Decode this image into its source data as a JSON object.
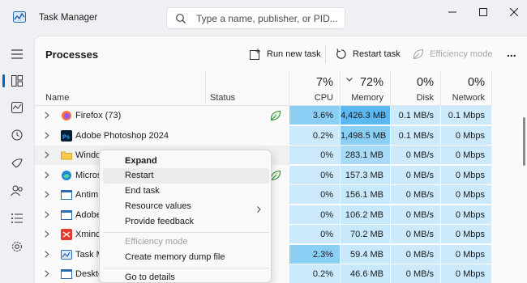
{
  "window": {
    "title": "Task Manager",
    "search_placeholder": "Type a name, publisher, or PID..."
  },
  "toolbar": {
    "page_title": "Processes",
    "run_new_task": "Run new task",
    "restart_task": "Restart task",
    "efficiency_mode": "Efficiency mode",
    "more": "..."
  },
  "columns": {
    "name": "Name",
    "status": "Status",
    "cpu": {
      "pct": "7%",
      "label": "CPU"
    },
    "memory": {
      "pct": "72%",
      "label": "Memory"
    },
    "disk": {
      "pct": "0%",
      "label": "Disk"
    },
    "network": {
      "pct": "0%",
      "label": "Network"
    }
  },
  "processes": [
    {
      "name": "Firefox (73)",
      "icon": "firefox-icon",
      "efficiency": true,
      "cpu": "3.6%",
      "memory": "4,426.3 MB",
      "disk": "0.1 MB/s",
      "network": "0.1 Mbps"
    },
    {
      "name": "Adobe Photoshop 2024",
      "icon": "photoshop-icon",
      "efficiency": false,
      "cpu": "0.2%",
      "memory": "1,498.5 MB",
      "disk": "0.1 MB/s",
      "network": "0 Mbps"
    },
    {
      "name": "Windo",
      "icon": "folder-icon",
      "efficiency": false,
      "cpu": "0%",
      "memory": "283.1 MB",
      "disk": "0 MB/s",
      "network": "0 Mbps"
    },
    {
      "name": "Micros",
      "icon": "edge-icon",
      "efficiency": true,
      "cpu": "0%",
      "memory": "157.3 MB",
      "disk": "0 MB/s",
      "network": "0 Mbps"
    },
    {
      "name": "Antim",
      "icon": "window-icon",
      "efficiency": false,
      "cpu": "0%",
      "memory": "156.1 MB",
      "disk": "0 MB/s",
      "network": "0 Mbps"
    },
    {
      "name": "Adobe",
      "icon": "window-icon",
      "efficiency": false,
      "cpu": "0%",
      "memory": "106.2 MB",
      "disk": "0 MB/s",
      "network": "0 Mbps"
    },
    {
      "name": "Xminc",
      "icon": "xmind-icon",
      "efficiency": false,
      "cpu": "0%",
      "memory": "70.2 MB",
      "disk": "0 MB/s",
      "network": "0 Mbps"
    },
    {
      "name": "Task M",
      "icon": "taskmanager-icon",
      "efficiency": false,
      "cpu": "2.3%",
      "memory": "59.4 MB",
      "disk": "0 MB/s",
      "network": "0 Mbps"
    },
    {
      "name": "Deskto",
      "icon": "window-icon",
      "efficiency": false,
      "cpu": "0.2%",
      "memory": "46.6 MB",
      "disk": "0 MB/s",
      "network": "0 Mbps"
    }
  ],
  "context_menu": {
    "expand": "Expand",
    "restart": "Restart",
    "end_task": "End task",
    "resource_values": "Resource values",
    "provide_feedback": "Provide feedback",
    "efficiency_mode": "Efficiency mode",
    "create_dump": "Create memory dump file",
    "go_to_details": "Go to details"
  }
}
